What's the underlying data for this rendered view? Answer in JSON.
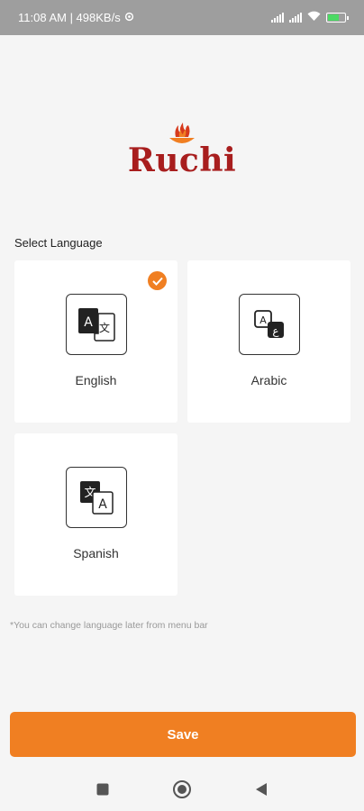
{
  "status_bar": {
    "time_and_speed": "11:08 AM | 498KB/s",
    "battery_color": "#4cd964"
  },
  "logo": {
    "text": "Ruchi",
    "color": "#a81e1e",
    "accent_color": "#f07f22"
  },
  "language_section": {
    "title": "Select Language",
    "options": [
      {
        "label": "English",
        "icon": "translate-icon",
        "selected": true
      },
      {
        "label": "Arabic",
        "icon": "language-icon",
        "selected": false
      },
      {
        "label": "Spanish",
        "icon": "g-translate-icon",
        "selected": false
      }
    ]
  },
  "hint": "*You can change language later from menu bar",
  "save_button": {
    "label": "Save",
    "color": "#f07f22"
  },
  "nav_bar": {
    "items": [
      "recent-apps-icon",
      "home-icon",
      "back-icon"
    ]
  }
}
